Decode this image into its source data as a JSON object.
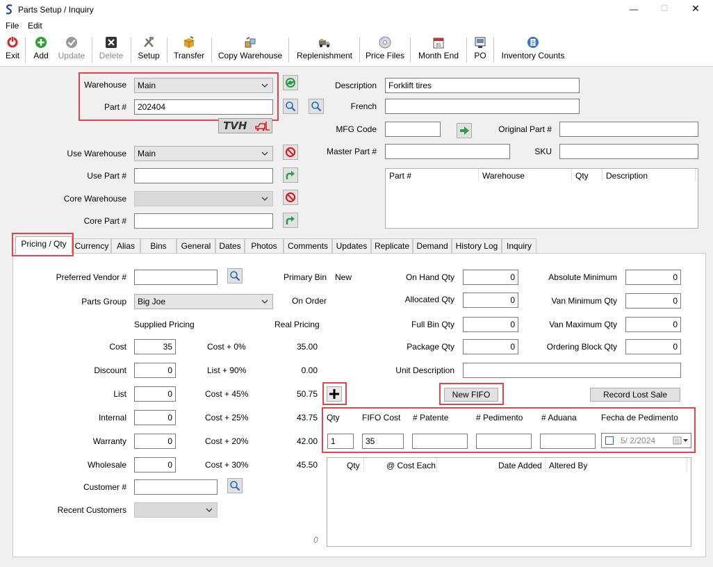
{
  "window": {
    "title": "Parts Setup / Inquiry",
    "min_glyph": "—",
    "max_glyph": "☐",
    "close_glyph": "✕"
  },
  "menu": [
    "File",
    "Edit"
  ],
  "toolbar": [
    {
      "label": "Exit",
      "icon": "exit-icon",
      "enabled": true
    },
    {
      "label": "Add",
      "icon": "add-icon",
      "enabled": true
    },
    {
      "label": "Update",
      "icon": "update-icon",
      "enabled": false
    },
    {
      "label": "Delete",
      "icon": "delete-icon",
      "enabled": false
    },
    {
      "label": "Setup",
      "icon": "tools-icon",
      "enabled": true
    },
    {
      "label": "Transfer",
      "icon": "transfer-box-icon",
      "enabled": true
    },
    {
      "label": "Copy Warehouse",
      "icon": "copy-warehouse-icon",
      "enabled": true
    },
    {
      "label": "Replenishment",
      "icon": "truck-icon",
      "enabled": true
    },
    {
      "label": "Price Files",
      "icon": "disc-icon",
      "enabled": true
    },
    {
      "label": "Month End",
      "icon": "calendar-icon",
      "enabled": true
    },
    {
      "label": "PO",
      "icon": "po-icon",
      "enabled": true
    },
    {
      "label": "Inventory Counts",
      "icon": "clipboard-icon",
      "enabled": true
    }
  ],
  "header": {
    "warehouse_label": "Warehouse",
    "warehouse_value": "Main",
    "part_label": "Part #",
    "part_value": "202404",
    "logo_text": "TVH",
    "use_warehouse_label": "Use Warehouse",
    "use_warehouse_value": "Main",
    "use_part_label": "Use Part #",
    "use_part_value": "",
    "core_warehouse_label": "Core Warehouse",
    "core_warehouse_value": "",
    "core_part_label": "Core Part #",
    "core_part_value": "",
    "description_label": "Description",
    "description_value": "Forklift tires",
    "french_label": "French",
    "french_value": "",
    "mfg_code_label": "MFG Code",
    "mfg_code_value": "",
    "original_part_label": "Original Part #",
    "original_part_value": "",
    "master_part_label": "Master Part #",
    "master_part_value": "",
    "sku_label": "SKU",
    "sku_value": "",
    "alt_grid_columns": [
      "Part #",
      "Warehouse",
      "Qty",
      "Description"
    ]
  },
  "tabs": [
    "Pricing / Qty",
    "Currency",
    "Alias",
    "Bins",
    "General",
    "Dates",
    "Photos",
    "Comments",
    "Updates",
    "Replicate",
    "Demand",
    "History Log",
    "Inquiry"
  ],
  "pricing": {
    "preferred_vendor_label": "Preferred Vendor #",
    "preferred_vendor_value": "",
    "parts_group_label": "Parts Group",
    "parts_group_value": "Big Joe",
    "supplied_pricing_label": "Supplied Pricing",
    "real_pricing_label": "Real Pricing",
    "primary_bin_label": "Primary Bin",
    "primary_bin_value": "New",
    "on_order_label": "On Order",
    "rows": [
      {
        "label": "Cost",
        "value": "35",
        "formula": "Cost + 0%",
        "real": "35.00"
      },
      {
        "label": "Discount",
        "value": "0",
        "formula": "List + 90%",
        "real": "0.00"
      },
      {
        "label": "List",
        "value": "0",
        "formula": "Cost + 45%",
        "real": "50.75"
      },
      {
        "label": "Internal",
        "value": "0",
        "formula": "Cost + 25%",
        "real": "43.75"
      },
      {
        "label": "Warranty",
        "value": "0",
        "formula": "Cost + 20%",
        "real": "42.00"
      },
      {
        "label": "Wholesale",
        "value": "0",
        "formula": "Cost + 30%",
        "real": "45.50"
      }
    ],
    "customer_label": "Customer #",
    "customer_value": "",
    "recent_customers_label": "Recent Customers",
    "recent_customers_value": "",
    "footer_count": "0"
  },
  "qty": {
    "on_hand_label": "On Hand Qty",
    "on_hand_value": "0",
    "allocated_label": "Allocated Qty",
    "allocated_value": "0",
    "full_bin_label": "Full Bin Qty",
    "full_bin_value": "0",
    "package_label": "Package Qty",
    "package_value": "0",
    "unit_description_label": "Unit Description",
    "unit_description_value": "",
    "absolute_minimum_label": "Absolute Minimum",
    "absolute_minimum_value": "0",
    "van_minimum_label": "Van Minimum Qty",
    "van_minimum_value": "0",
    "van_maximum_label": "Van Maximum Qty",
    "van_maximum_value": "0",
    "ordering_block_label": "Ordering Block Qty",
    "ordering_block_value": "0"
  },
  "fifo": {
    "new_fifo_label": "New FIFO",
    "record_lost_sale_label": "Record Lost Sale",
    "columns": [
      "Qty",
      "FIFO Cost",
      "# Patente",
      "# Pedimento",
      "# Aduana",
      "Fecha de Pedimento"
    ],
    "qty_value": "1",
    "cost_value": "35",
    "patente_value": "",
    "pedimento_value": "",
    "aduana_value": "",
    "fecha_value": "5/  2/2024",
    "grid_columns": [
      "Qty",
      "@ Cost Each",
      "Date Added",
      "Altered By"
    ]
  },
  "colors": {
    "highlight": "#e0454a",
    "accent": "#0078d7"
  }
}
